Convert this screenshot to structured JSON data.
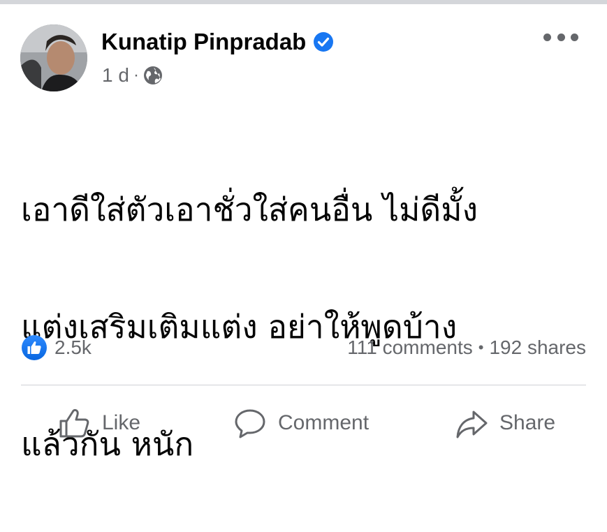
{
  "post": {
    "author": "Kunatip Pinpradab",
    "verified": true,
    "timestamp": "1 d",
    "separator": "·",
    "privacy_icon": "globe-icon",
    "text_lines": [
      "เอาดีใส่ตัวเอาชั่วใส่คนอื่น ไม่ดีมั้ง",
      "แต่งเสริมเติมแต่ง อย่าให้พูดบ้าง",
      "แล้วกัน หนัก"
    ]
  },
  "stats": {
    "reaction_count": "2.5k",
    "comments": "111 comments",
    "separator": "•",
    "shares": "192 shares"
  },
  "actions": {
    "like_label": "Like",
    "comment_label": "Comment",
    "share_label": "Share"
  },
  "colors": {
    "verified_blue": "#1877f2",
    "secondary_text": "#65676b",
    "primary_text": "#050505",
    "divider": "#ced0d4"
  }
}
